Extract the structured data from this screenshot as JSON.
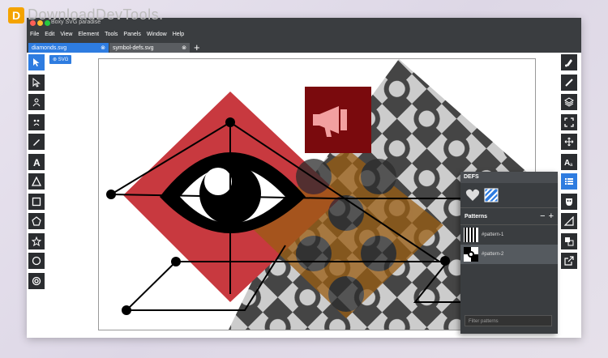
{
  "watermark": {
    "text": "DownloadDevTools."
  },
  "window": {
    "title": "Boxy SVG paradise"
  },
  "menu": [
    "File",
    "Edit",
    "View",
    "Element",
    "Tools",
    "Panels",
    "Window",
    "Help"
  ],
  "tabs": [
    {
      "label": "diamonds.svg",
      "active": true
    },
    {
      "label": "symbol-defs.svg",
      "active": false
    }
  ],
  "left_tools": [
    "pointer-icon",
    "node-pointer-icon",
    "person-icon",
    "face-icon",
    "pen-icon",
    "text-icon",
    "triangle-icon",
    "square-icon",
    "pentagon-icon",
    "star-icon",
    "circle-icon",
    "ring-icon"
  ],
  "right_tools": [
    "brush-icon",
    "paintbrush-icon",
    "layers-icon",
    "fullscreen-icon",
    "move-icon",
    "font-icon",
    "defs-panel-icon",
    "mask-icon",
    "ruler-icon",
    "arrange-icon",
    "export-icon"
  ],
  "svg_badge": "SVG",
  "defs": {
    "header": "DEFS",
    "patterns_header": "Patterns",
    "patterns": [
      {
        "label": "#pattern-1",
        "selected": false
      },
      {
        "label": "#pattern-2",
        "selected": true
      }
    ],
    "filter_placeholder": "Filter patterns"
  },
  "colors": {
    "accent": "#2e7ce0",
    "toolbar": "#2b2d30",
    "chrome": "#3a3d40",
    "red": "#c8393f",
    "darkred": "#7a0a0d",
    "orange": "#b06b14"
  }
}
